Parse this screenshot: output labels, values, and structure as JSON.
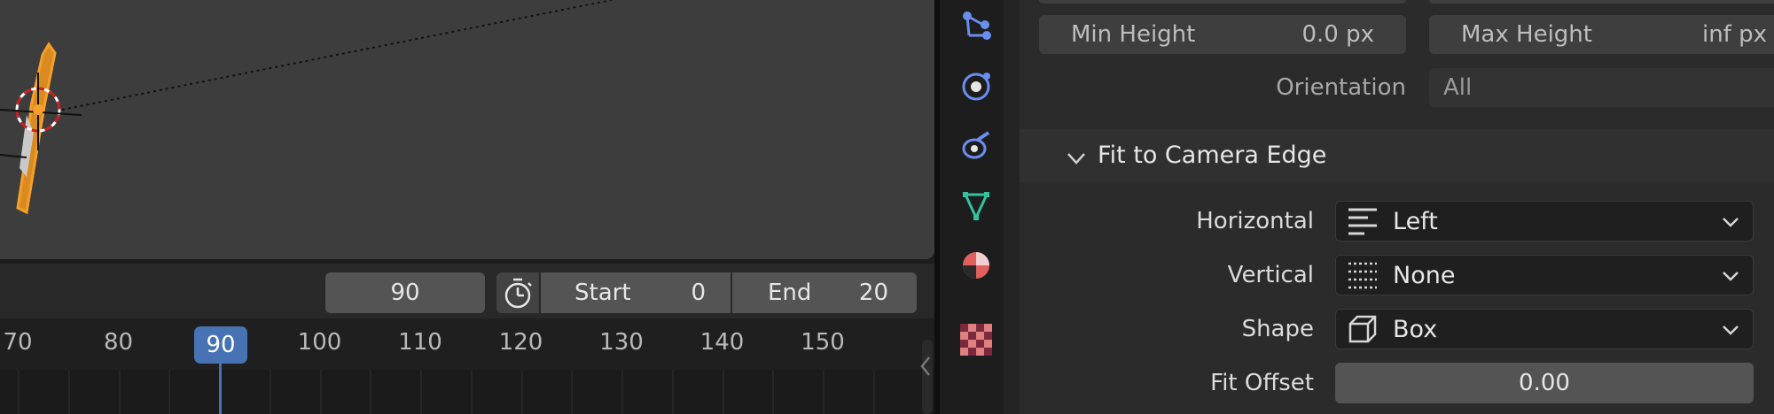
{
  "timeline": {
    "current_frame": "90",
    "start_label": "Start",
    "start_value": "0",
    "end_label": "End",
    "end_value": "20",
    "ruler_ticks": [
      "70",
      "80",
      "90",
      "100",
      "110",
      "120",
      "130",
      "140",
      "150"
    ],
    "playhead_frame": "90"
  },
  "tabs": [
    {
      "icon": "particles-icon",
      "color": "#6a8ef0"
    },
    {
      "icon": "physics-icon",
      "color": "#6a8ef0"
    },
    {
      "icon": "object-constraint-icon",
      "color": "#6a8ef0"
    },
    {
      "icon": "object-data-icon",
      "color": "#33c2a0"
    },
    {
      "icon": "material-icon",
      "color": "#e06060"
    },
    {
      "icon": "texture-icon",
      "color": "#c05070"
    }
  ],
  "properties": {
    "min_height_label": "Min Height",
    "min_height_value": "0.0 px",
    "max_height_label": "Max Height",
    "max_height_value": "inf px",
    "orientation_label": "Orientation",
    "orientation_value": "All",
    "section_title": "Fit to Camera Edge",
    "horizontal_label": "Horizontal",
    "horizontal_value": "Left",
    "vertical_label": "Vertical",
    "vertical_value": "None",
    "shape_label": "Shape",
    "shape_value": "Box",
    "fit_offset_label": "Fit Offset",
    "fit_offset_value": "0.00"
  },
  "colors": {
    "accent": "#4772b3",
    "selection_orange": "#f5a02a"
  }
}
